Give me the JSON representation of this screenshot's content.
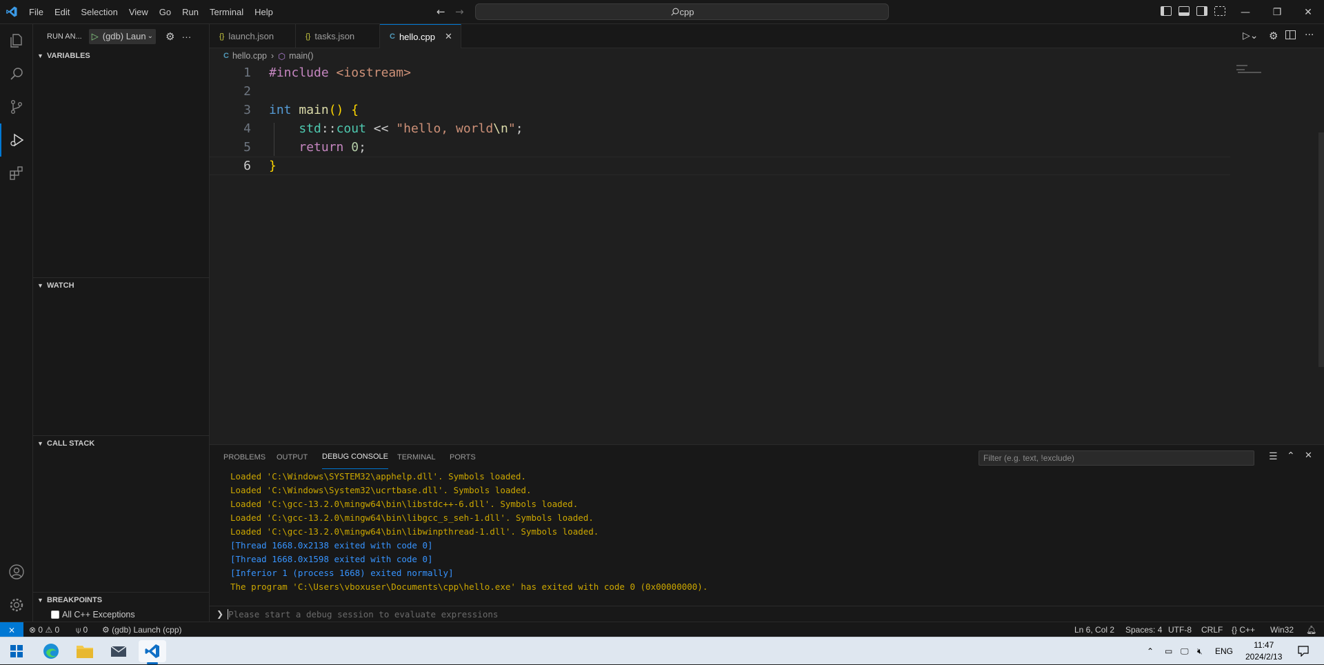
{
  "menu": [
    "File",
    "Edit",
    "Selection",
    "View",
    "Go",
    "Run",
    "Terminal",
    "Help"
  ],
  "search": {
    "text": "cpp"
  },
  "sidebar": {
    "title": "RUN AN...",
    "config": "(gdb) Laun",
    "sections": {
      "variables": "VARIABLES",
      "watch": "WATCH",
      "call_stack": "CALL STACK",
      "breakpoints": "BREAKPOINTS"
    },
    "breakpoint_item": "All C++ Exceptions"
  },
  "tabs": [
    {
      "label": "launch.json",
      "icon": "{}"
    },
    {
      "label": "tasks.json",
      "icon": "{}"
    },
    {
      "label": "hello.cpp",
      "icon": "C"
    }
  ],
  "breadcrumb": {
    "file": "hello.cpp",
    "symbol": "main()"
  },
  "code_lines": [
    "1",
    "2",
    "3",
    "4",
    "5",
    "6"
  ],
  "panel": {
    "tabs": [
      "PROBLEMS",
      "OUTPUT",
      "DEBUG CONSOLE",
      "TERMINAL",
      "PORTS"
    ],
    "filter_placeholder": "Filter (e.g. text, !exclude)",
    "console": [
      "Loaded 'C:\\Windows\\SYSTEM32\\apphelp.dll'. Symbols loaded.",
      "Loaded 'C:\\Windows\\System32\\ucrtbase.dll'. Symbols loaded.",
      "Loaded 'C:\\gcc-13.2.0\\mingw64\\bin\\libstdc++-6.dll'. Symbols loaded.",
      "Loaded 'C:\\gcc-13.2.0\\mingw64\\bin\\libgcc_s_seh-1.dll'. Symbols loaded.",
      "Loaded 'C:\\gcc-13.2.0\\mingw64\\bin\\libwinpthread-1.dll'. Symbols loaded.",
      "[Thread 1668.0x2138 exited with code 0]",
      "[Thread 1668.0x1598 exited with code 0]",
      "[Inferior 1 (process 1668) exited normally]",
      "The program 'C:\\Users\\vboxuser\\Documents\\cpp\\hello.exe' has exited with code 0 (0x00000000)."
    ],
    "input_placeholder": "Please start a debug session to evaluate expressions"
  },
  "status": {
    "errors": "0",
    "warnings": "0",
    "ports": "0",
    "launch": "(gdb) Launch (cpp)",
    "position": "Ln 6, Col 2",
    "spaces": "Spaces: 4",
    "encoding": "UTF-8",
    "eol": "CRLF",
    "language": "C++",
    "platform": "Win32"
  },
  "tray": {
    "lang": "ENG",
    "time": "11:47",
    "date": "2024/2/13"
  },
  "colors": {
    "accent": "#0078d4",
    "remote": "#0078d4",
    "console_yellow": "#cca700",
    "console_blue": "#3794ff"
  }
}
